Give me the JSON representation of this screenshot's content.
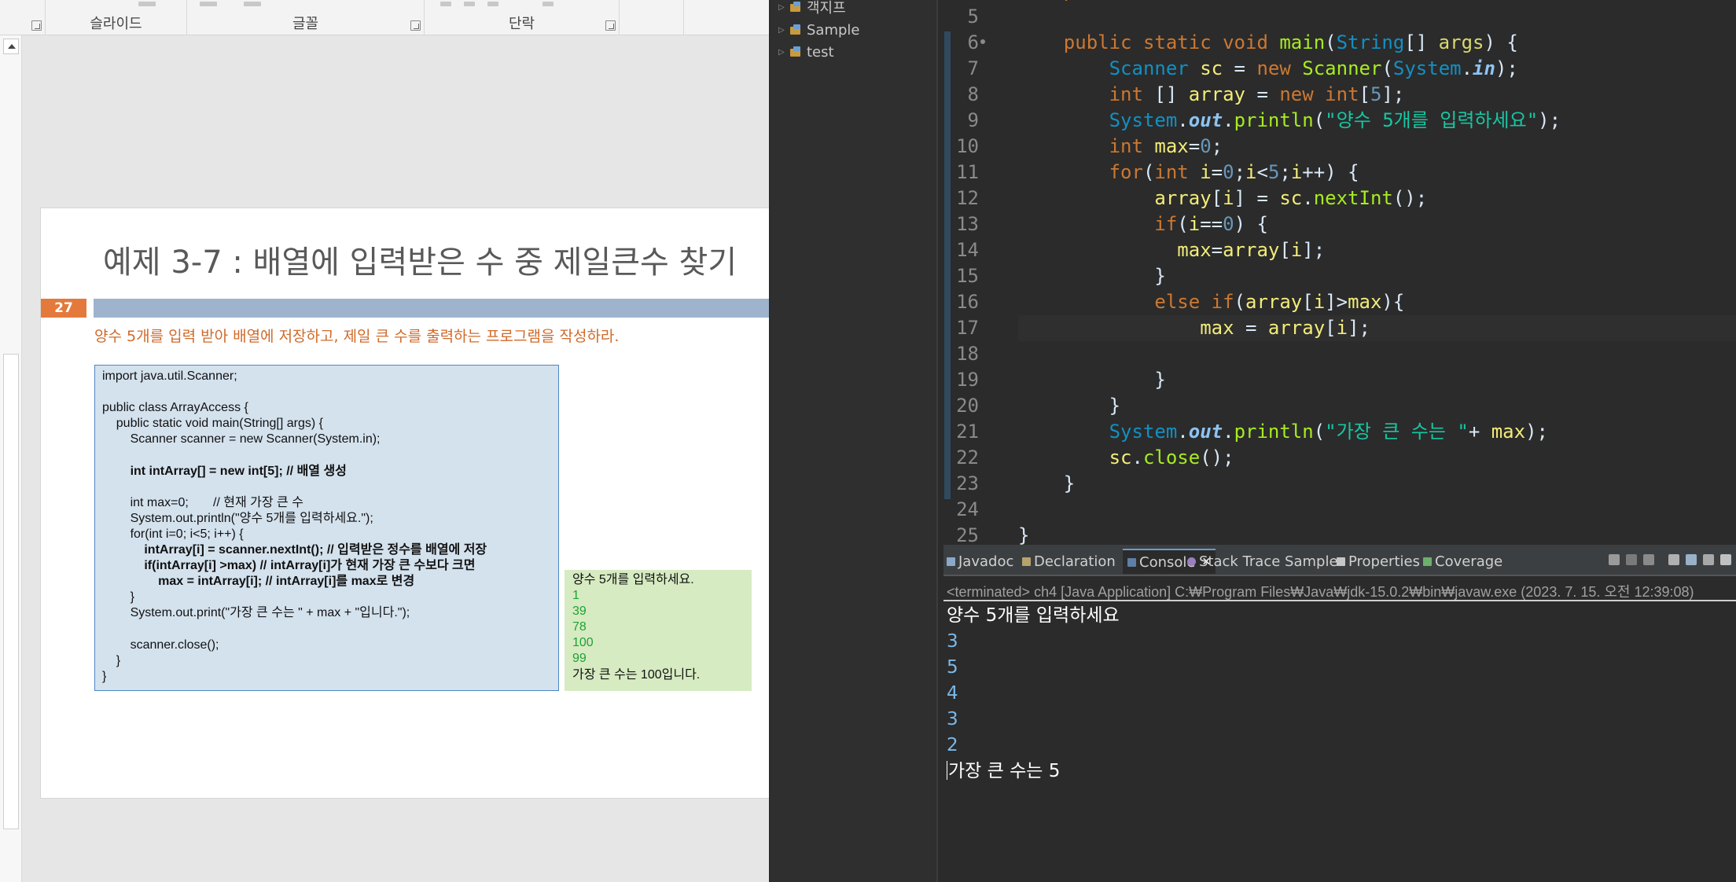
{
  "ribbon": {
    "groups": [
      {
        "label": "슬라이드"
      },
      {
        "label": "글꼴"
      },
      {
        "label": "단락"
      }
    ]
  },
  "slide": {
    "number": "27",
    "title": "예제 3-7 : 배열에 입력받은 수 중 제일큰수 찾기",
    "subtitle": "양수 5개를 입력 받아 배열에 저장하고, 제일 큰 수를 출력하는 프로그램을 작성하라.",
    "code_lines": [
      "import java.util.Scanner;",
      "",
      "public class ArrayAccess {",
      "    public static void main(String[] args) {",
      "        Scanner scanner = new Scanner(System.in);",
      "",
      "        int intArray[] = new int[5]; // 배열 생성",
      "",
      "        int max=0;       // 현재 가장 큰 수",
      "        System.out.println(\"양수 5개를 입력하세요.\");",
      "        for(int i=0; i<5; i++) {",
      "            intArray[i] = scanner.nextInt(); // 입력받은 정수를 배열에 저장",
      "            if(intArray[i] >max) // intArray[i]가 현재 가장 큰 수보다 크면",
      "                max = intArray[i]; // intArray[i]를 max로 변경",
      "        }",
      "        System.out.print(\"가장 큰 수는 \" + max + \"입니다.\");",
      "",
      "        scanner.close();",
      "    }",
      "}"
    ],
    "output_prompt": "양수 5개를 입력하세요.",
    "output_inputs": [
      "1",
      "39",
      "78",
      "100",
      "99"
    ],
    "output_result": "가장 큰 수는 100입니다."
  },
  "explorer": {
    "projects": [
      "객지프",
      "Sample",
      "test"
    ]
  },
  "editor": {
    "line_numbers": [
      "5",
      "6",
      "7",
      "8",
      "9",
      "10",
      "11",
      "12",
      "13",
      "14",
      "15",
      "16",
      "17",
      "18",
      "19",
      "20",
      "21",
      "22",
      "23",
      "24",
      "25"
    ]
  },
  "views": {
    "tabs": [
      "Javadoc",
      "Declaration",
      "Console",
      "Stack Trace Sample",
      "Properties",
      "Coverage"
    ],
    "active_tab": "Console",
    "status": "<terminated> ch4 [Java Application] C:₩Program Files₩Java₩jdk-15.0.2₩bin₩javaw.exe (2023. 7. 15. 오전 12:39:08)",
    "console_prompt": "양수 5개를 입력하세요",
    "console_inputs": [
      "3",
      "5",
      "4",
      "3",
      "2"
    ],
    "console_result": "가장 큰 수는 5"
  },
  "colors": {
    "slide_accent": "#e37a3c",
    "slide_bar": "#9db4cc",
    "code_box_bg": "#d4e2ee",
    "output_box_bg": "#d6ebc2",
    "eclipse_bg": "#2b2b2b",
    "keyword": "#cc7832",
    "type": "#1290c3",
    "method": "#a7ec21",
    "string": "#17c6a3"
  }
}
